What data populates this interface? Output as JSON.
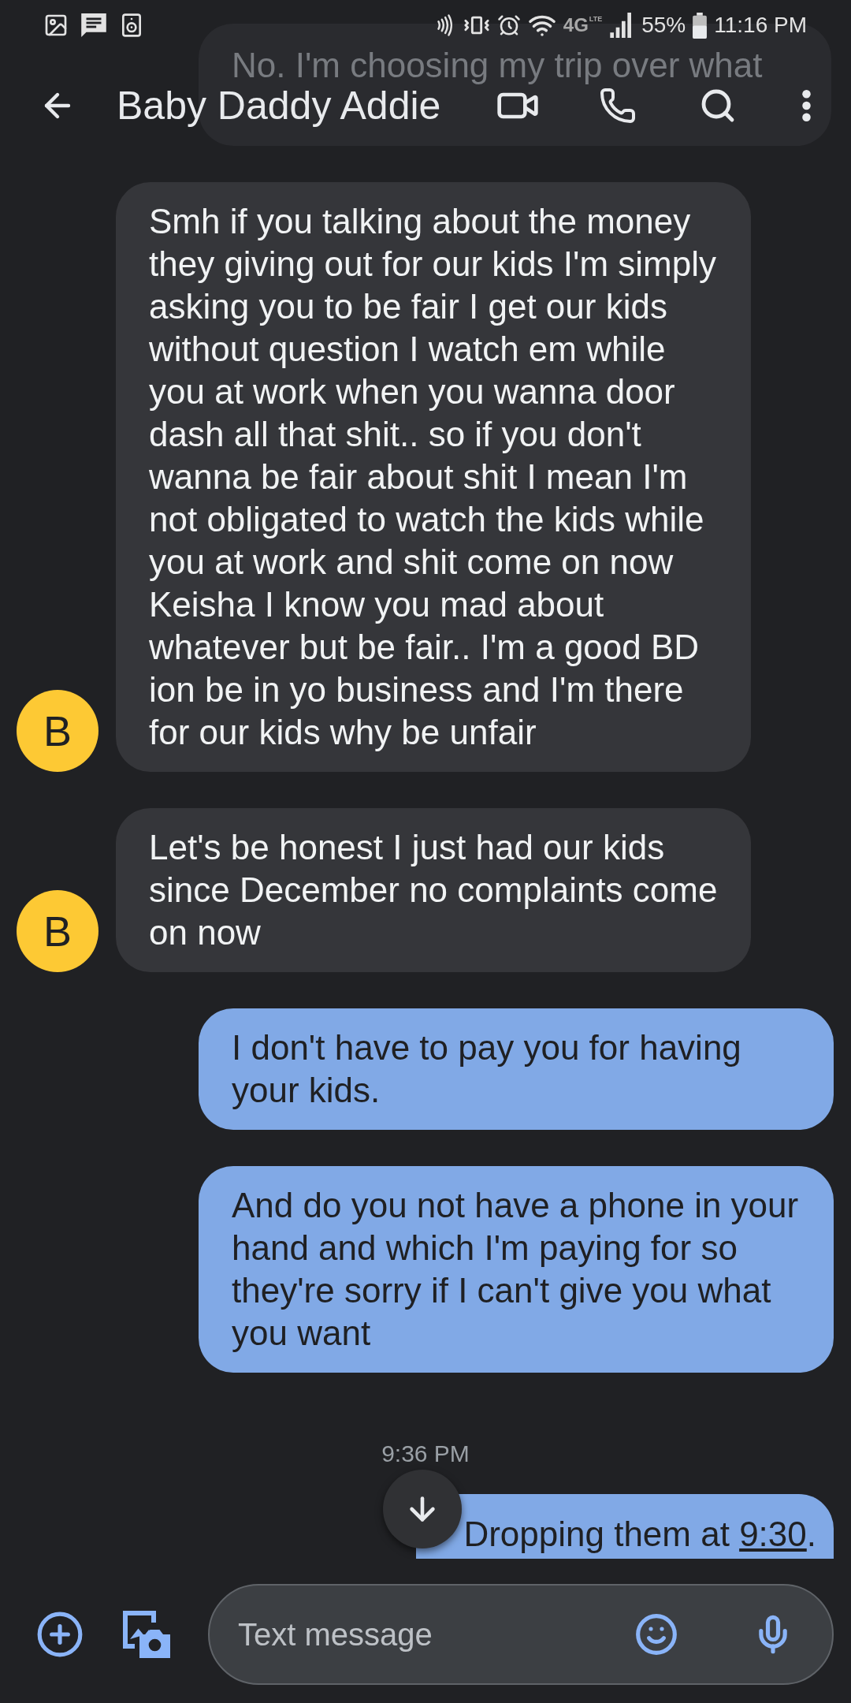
{
  "status_bar": {
    "network": "4G",
    "network_sub": "LTE",
    "battery": "55%",
    "time": "11:16 PM"
  },
  "header": {
    "title": "Baby Daddy Addie"
  },
  "messages": [
    {
      "kind": "under_header",
      "text": "No. I'm choosing my trip over what"
    },
    {
      "kind": "incoming",
      "avatar": "B",
      "clipped": false,
      "text": "Smh if you talking about the money they giving out for our kids I'm simply asking you to be fair I get our kids without question I watch em while you at work when you wanna door dash all that shit.. so if you don't wanna be fair about shit I mean I'm not obligated to watch the kids while you at work and shit come on now Keisha I know you mad about whatever but be fair.. I'm a good BD ion be in yo business and I'm there for our kids why be unfair"
    },
    {
      "kind": "incoming",
      "avatar": "B",
      "clipped": false,
      "text": "Let's be honest I just had our kids since December no complaints come on now"
    },
    {
      "kind": "outgoing",
      "clipped": false,
      "text": "I don't have to pay you for having your kids."
    },
    {
      "kind": "outgoing",
      "clipped": false,
      "text": "And do you not have a phone in your hand and which I'm paying for so they're sorry if I can't give you what you want"
    },
    {
      "kind": "timestamp",
      "text": "9:36 PM"
    },
    {
      "kind": "outgoing",
      "clipped": true,
      "text": "Dropping them at ",
      "link": "9:30",
      "text_after": "."
    }
  ],
  "composer": {
    "placeholder": "Text message"
  }
}
